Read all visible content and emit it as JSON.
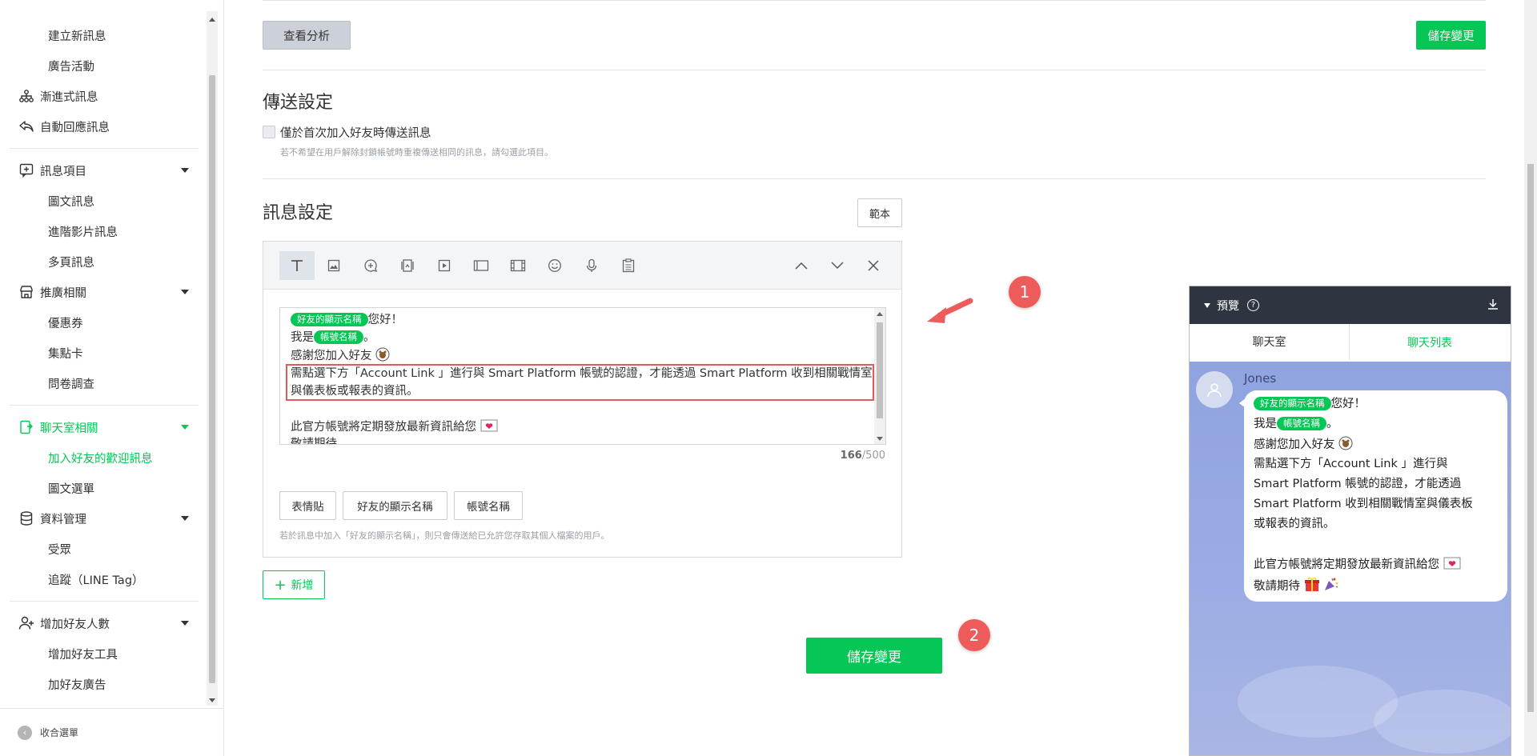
{
  "sidebar": {
    "top_items": [
      "建立新訊息",
      "廣告活動"
    ],
    "group_step": "漸進式訊息",
    "group_auto": "自動回應訊息",
    "group_msg": "訊息項目",
    "msg_items": [
      "圖文訊息",
      "進階影片訊息",
      "多頁訊息"
    ],
    "group_promo": "推廣相關",
    "promo_items": [
      "優惠券",
      "集點卡",
      "問卷調查"
    ],
    "group_chat": "聊天室相關",
    "chat_items": [
      "加入好友的歡迎訊息",
      "圖文選單"
    ],
    "group_data": "資料管理",
    "data_items": [
      "受眾",
      "追蹤（LINE Tag）"
    ],
    "group_friends": "增加好友人數",
    "friends_items": [
      "增加好友工具",
      "加好友廣告"
    ],
    "collapse": "收合選單"
  },
  "main": {
    "view_analysis": "查看分析",
    "save_top": "儲存變更",
    "send_title": "傳送設定",
    "send_checkbox": "僅於首次加入好友時傳送訊息",
    "send_hint": "若不希望在用戶解除封鎖帳號時重複傳送相同的訊息，請勾選此項目。",
    "msg_title": "訊息設定",
    "template_btn": "範本",
    "editor": {
      "chip_friend": "好友的顯示名稱",
      "chip_account": "帳號名稱",
      "l1_suffix": "您好！",
      "l2_prefix": "我是",
      "l2_suffix": "。",
      "l3": "感謝您加入好友",
      "l4": "需點選下方「Account Link 」進行與 Smart Platform 帳號的認證，才能透過 Smart Platform 收到相關戰情室",
      "l5": "與儀表板或報表的資訊。",
      "l7": "此官方帳號將定期發放最新資訊給您",
      "l8": "敬請期待",
      "count_used": "166",
      "count_max": "/500",
      "btn_sticker": "表情貼",
      "btn_friend": "好友的顯示名稱",
      "btn_account": "帳號名稱",
      "hint": "若於訊息中加入「好友的顯示名稱」，則只會傳送給已允許您存取其個人檔案的用戶。"
    },
    "add_btn": "新增",
    "save_bottom": "儲存變更",
    "badge1": "1",
    "badge2": "2"
  },
  "preview": {
    "title": "預覽",
    "tab_chat": "聊天室",
    "tab_list": "聊天列表",
    "sender": "Jones",
    "chip_friend": "好友的顯示名稱",
    "chip_account": "帳號名稱",
    "l1_suffix": "您好！",
    "l2_prefix": "我是",
    "l2_suffix": "。",
    "l3": "感謝您加入好友",
    "l4": "需點選下方「Account Link 」進行與",
    "l5": "Smart Platform 帳號的認證，才能透過",
    "l6": "Smart Platform 收到相關戰情室與儀表板",
    "l7": "或報表的資訊。",
    "l9": "此官方帳號將定期發放最新資訊給您",
    "l10": "敬請期待"
  },
  "colors": {
    "accent": "#06c755",
    "annotation": "#ee5b5b",
    "preview_header": "#2e3440",
    "chat_bg": "#8fa3e0"
  }
}
